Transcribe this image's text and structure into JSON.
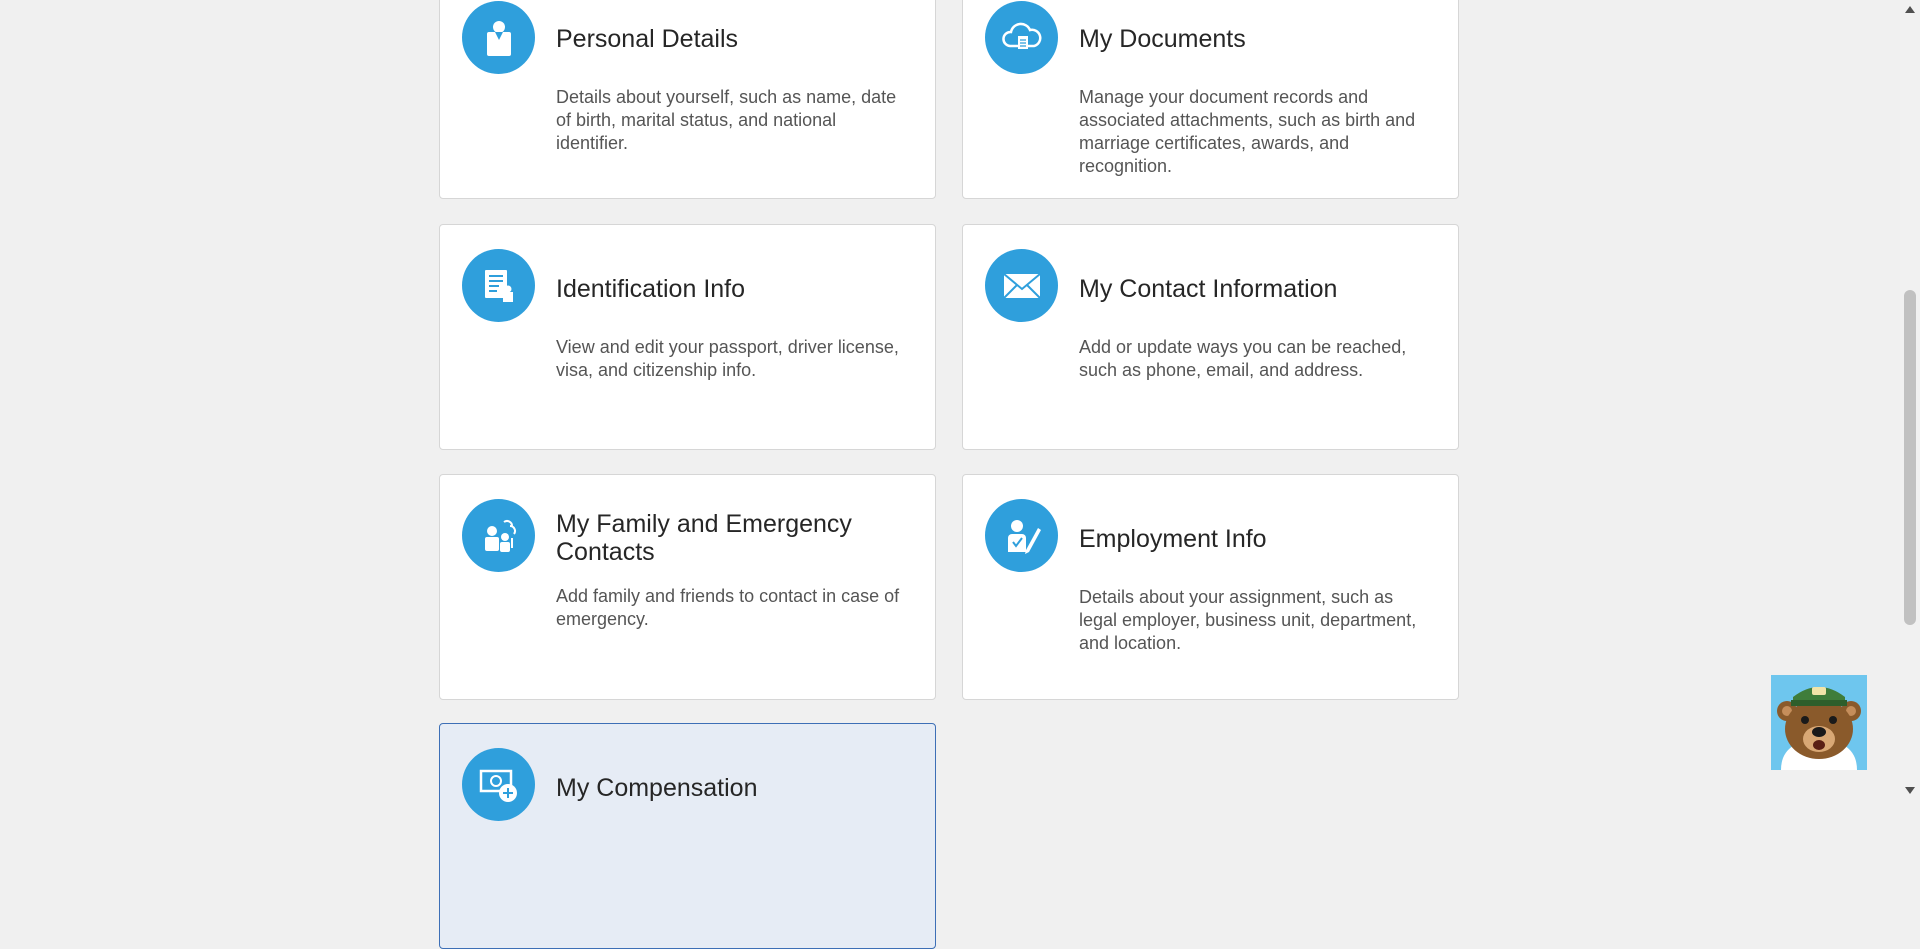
{
  "cards": [
    {
      "title": "Personal Details",
      "description": "Details about yourself, such as name, date of birth, marital status, and national identifier.",
      "icon": "person-card-icon"
    },
    {
      "title": "My Documents",
      "description": "Manage your document records and associated attachments, such as birth and marriage certificates, awards, and recognition.",
      "icon": "cloud-document-icon"
    },
    {
      "title": "Identification Info",
      "description": "View and edit your passport, driver license, visa, and citizenship info.",
      "icon": "id-document-icon"
    },
    {
      "title": "My Contact Information",
      "description": "Add or update ways you can be reached, such as phone, email, and address.",
      "icon": "envelope-icon"
    },
    {
      "title": "My Family and Emergency Contacts",
      "description": "Add family and friends to contact in case of emergency.",
      "icon": "family-contacts-icon"
    },
    {
      "title": "Employment Info",
      "description": "Details about your assignment, such as legal employer, business unit, department, and location.",
      "icon": "employee-edit-icon"
    },
    {
      "title": "My Compensation",
      "description": "",
      "icon": "compensation-icon"
    }
  ],
  "colors": {
    "icon_bg": "#2f9fdc",
    "selected_card_bg": "#e6ecf5",
    "selected_card_border": "#3d6fb6",
    "page_bg": "#f0f0f0"
  },
  "assistant": {
    "icon": "bear-mascot-icon"
  }
}
